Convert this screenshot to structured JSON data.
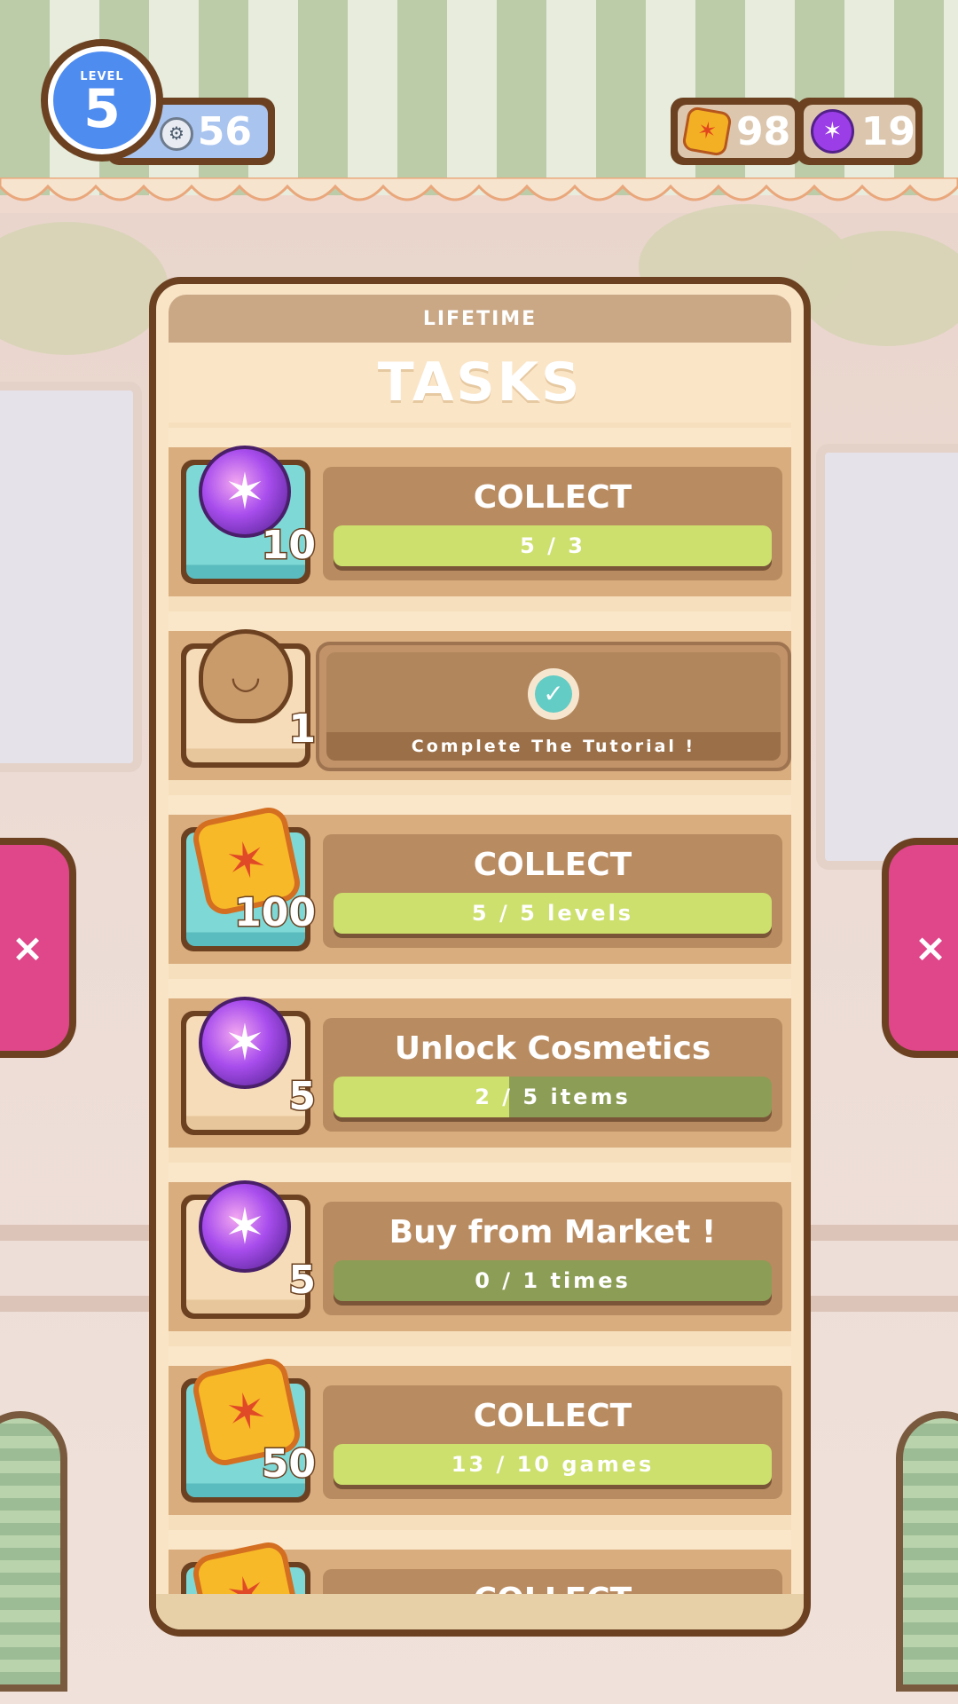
{
  "hud": {
    "level_caption": "LEVEL",
    "level": "5",
    "xp": "56",
    "coins": "98",
    "gems": "19",
    "xp_icon": "gear-badge-icon",
    "coin_icon": "star-coin-icon",
    "gem_icon": "purple-gem-icon"
  },
  "side_buttons": {
    "left_label": "×",
    "right_label": "×"
  },
  "panel": {
    "tab_label": "LIFETIME",
    "title": "TASKS"
  },
  "tasks": [
    {
      "reward_type": "gem",
      "reward_amount": "10",
      "tile": "teal",
      "label": "COLLECT",
      "progress_text": "5 / 3",
      "progress": 1.0
    },
    {
      "reward_type": "bag",
      "reward_amount": "1",
      "tile": "plain",
      "completed": true,
      "label": "Complete The Tutorial !"
    },
    {
      "reward_type": "coin",
      "reward_amount": "100",
      "tile": "teal",
      "label": "COLLECT",
      "progress_text": "5 / 5 levels",
      "progress": 1.0
    },
    {
      "reward_type": "gem",
      "reward_amount": "5",
      "tile": "plain",
      "label": "Unlock Cosmetics",
      "progress_text": "2 / 5 items",
      "progress": 0.4
    },
    {
      "reward_type": "gem",
      "reward_amount": "5",
      "tile": "plain",
      "label": "Buy from Market !",
      "progress_text": "0 / 1 times",
      "progress": 0.0
    },
    {
      "reward_type": "coin",
      "reward_amount": "50",
      "tile": "teal",
      "label": "COLLECT",
      "progress_text": "13 / 10 games",
      "progress": 1.0
    },
    {
      "reward_type": "coin",
      "reward_amount": "",
      "tile": "teal",
      "label": "COLLECT",
      "progress_text": "",
      "progress": 0.0
    }
  ],
  "colors": {
    "progress_fill": "#cde06d",
    "progress_empty": "#8c9d55",
    "side_button": "#e0468a",
    "outline": "#6b4121"
  }
}
